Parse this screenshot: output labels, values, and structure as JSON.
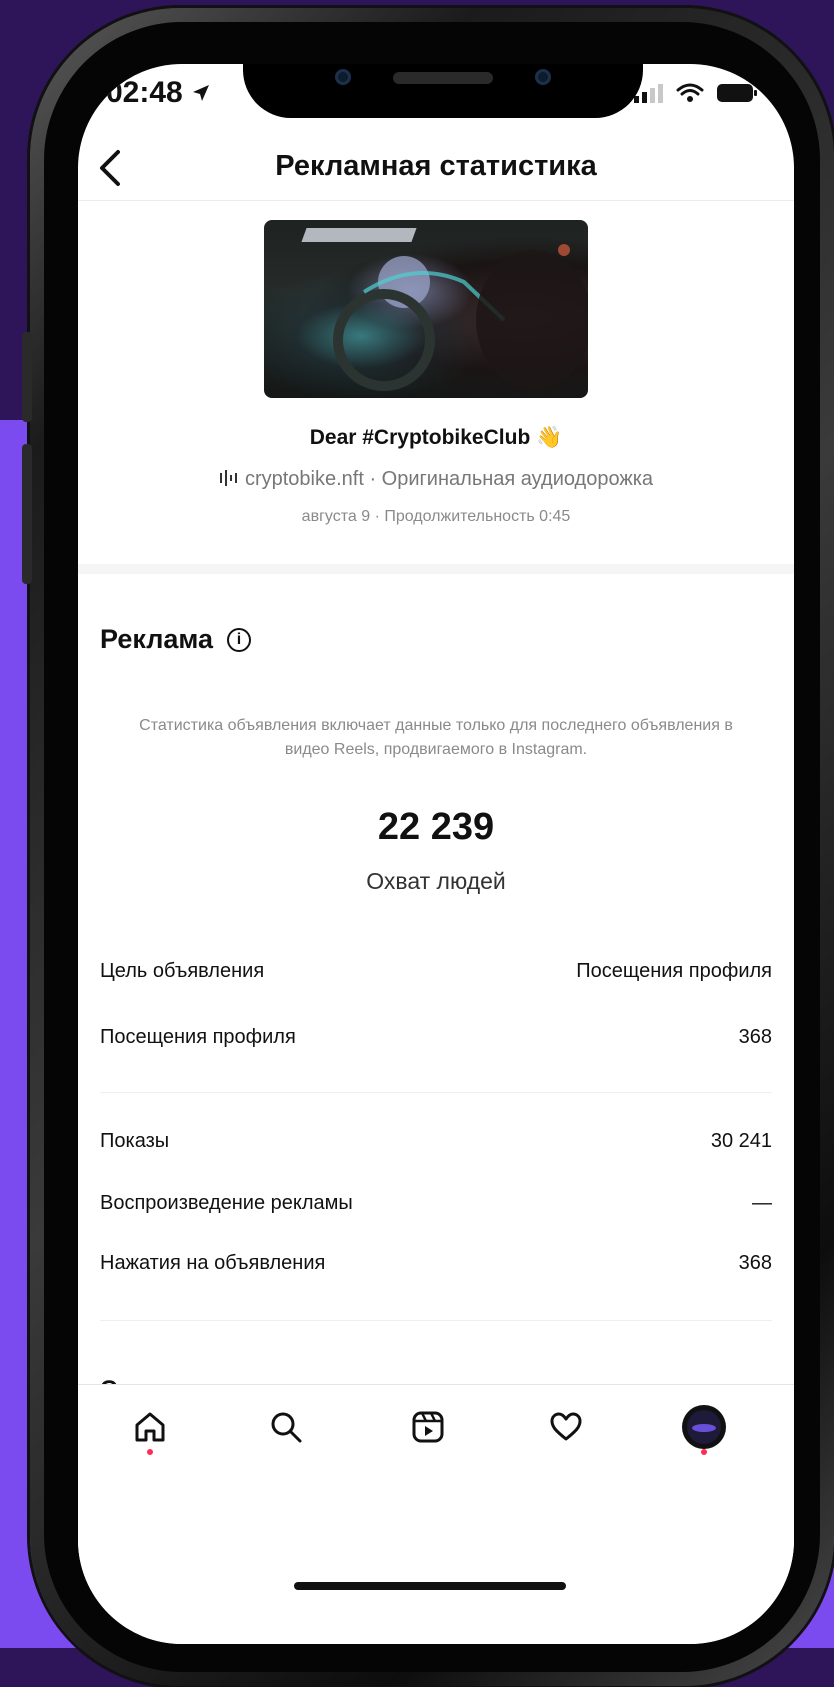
{
  "status_bar": {
    "time": "02:48"
  },
  "header": {
    "title": "Рекламная статистика"
  },
  "post": {
    "title": "Dear #CryptobikeClub 👋",
    "audio": "cryptobike.nft · Оригинальная аудиодорожка",
    "meta": "августа 9 · Продолжительность 0:45"
  },
  "ads": {
    "section_title": "Реклама",
    "disclaimer": "Статистика объявления включает данные только для последнего объявления в видео Reels, продвигаемого в Instagram.",
    "reach_value": "22 239",
    "reach_label": "Охват людей",
    "rows": [
      {
        "label": "Цель объявления",
        "value": "Посещения профиля"
      },
      {
        "label": "Посещения профиля",
        "value": "368"
      },
      {
        "label": "Показы",
        "value": "30 241"
      },
      {
        "label": "Воспроизведение рекламы",
        "value": "—"
      },
      {
        "label": "Нажатия на объявления",
        "value": "368"
      }
    ],
    "status_title": "Статус рекламы"
  },
  "tabbar": {
    "items": [
      "home-icon",
      "search-icon",
      "reels-icon",
      "heart-icon",
      "profile-avatar"
    ]
  },
  "colors": {
    "accent_dot": "#ff2d55",
    "bg_purple": "#7c4bf0",
    "bg_dark": "#2e1458"
  }
}
